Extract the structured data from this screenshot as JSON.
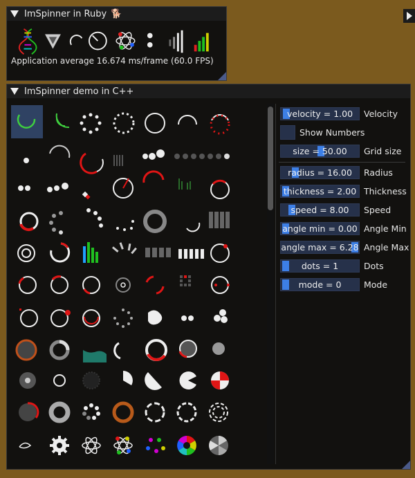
{
  "ruby_window": {
    "title": "ImSpinner in Ruby",
    "fps_text": "Application average 16.674 ms/frame (60.0 FPS)"
  },
  "demo_window": {
    "title": "ImSpinner demo in C++"
  },
  "controls": {
    "velocity": {
      "value_text": "velocity = 1.00",
      "label": "Velocity",
      "fraction": 0.1
    },
    "show_numbers": {
      "label": "Show Numbers",
      "checked": false
    },
    "size": {
      "value_text": "size = 50.00",
      "label": "Grid size",
      "fraction": 0.5
    },
    "radius": {
      "value_text": "radius = 16.00",
      "label": "Radius",
      "fraction": 0.16
    },
    "thickness": {
      "value_text": "thickness = 2.00",
      "label": "Thickness",
      "fraction": 0.02
    },
    "speed": {
      "value_text": "speed = 8.00",
      "label": "Speed",
      "fraction": 0.1
    },
    "angle_min": {
      "value_text": "angle min = 0.00",
      "label": "Angle Min",
      "fraction": 0.0
    },
    "angle_max": {
      "value_text": "angle max = 6.28",
      "label": "Angle Max",
      "fraction": 1.0
    },
    "dots": {
      "value_text": "dots = 1",
      "label": "Dots",
      "fraction": 0.0
    },
    "mode": {
      "value_text": "mode = 0",
      "label": "Mode",
      "fraction": 0.0
    }
  },
  "colors": {
    "accent": "#3d7fe6",
    "red": "#e01515",
    "frame_bg": "#26314a"
  }
}
